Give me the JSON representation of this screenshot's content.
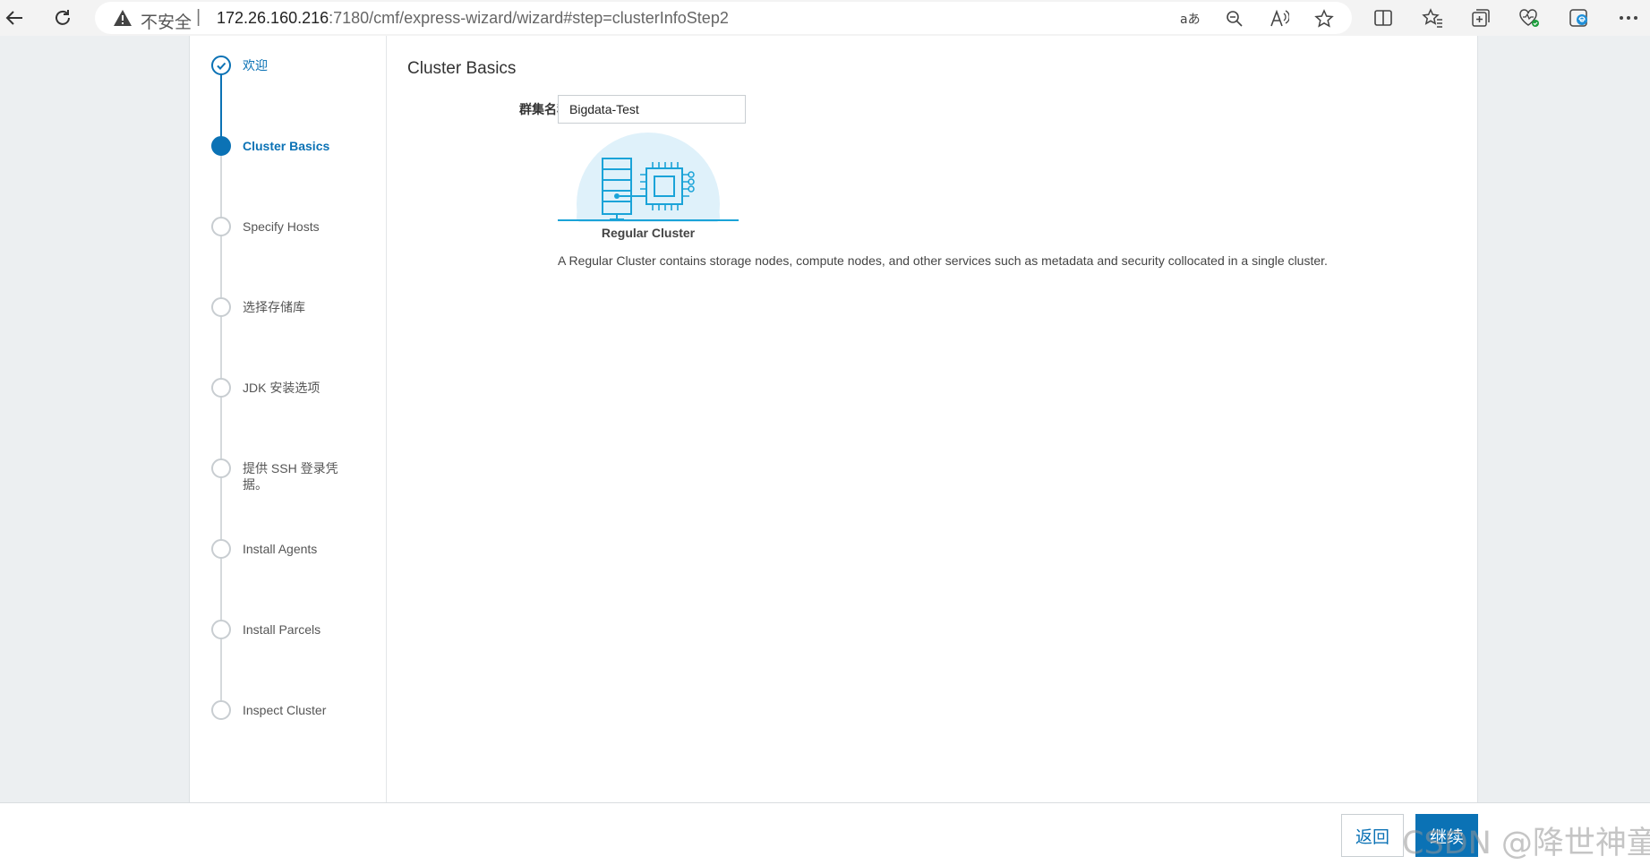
{
  "browser": {
    "security_label": "不安全",
    "separator": "|",
    "url_host": "172.26.160.216",
    "url_path": ":7180/cmf/express-wizard/wizard#step=clusterInfoStep2",
    "icons": [
      "back-icon",
      "reload-icon",
      "warning-icon",
      "translate-icon",
      "zoom-out-icon",
      "read-aloud-icon",
      "favorite-star-icon",
      "split-screen-icon",
      "favorites-icon",
      "collections-icon",
      "browser-essentials-icon",
      "edge-sidebar-icon",
      "more-icon"
    ]
  },
  "wizard": {
    "steps": [
      {
        "label": "欢迎",
        "state": "done"
      },
      {
        "label": "Cluster Basics",
        "state": "active"
      },
      {
        "label": "Specify Hosts",
        "state": "pending"
      },
      {
        "label": "选择存储库",
        "state": "pending"
      },
      {
        "label": "JDK 安装选项",
        "state": "pending"
      },
      {
        "label": "提供 SSH 登录凭据。",
        "state": "pending"
      },
      {
        "label": "Install Agents",
        "state": "pending"
      },
      {
        "label": "Install Parcels",
        "state": "pending"
      },
      {
        "label": "Inspect Cluster",
        "state": "pending"
      }
    ]
  },
  "main": {
    "section_title": "Cluster Basics",
    "cluster_name_label": "群集名称",
    "cluster_name_value": "Bigdata-Test",
    "cluster_type_label": "Regular Cluster",
    "cluster_type_description": "A Regular Cluster contains storage nodes, compute nodes, and other services such as metadata and security collocated in a single cluster."
  },
  "footer": {
    "back_label": "返回",
    "next_label": "继续",
    "watermark": "CSDN @降世神童"
  },
  "colors": {
    "accent": "#0b72b5",
    "illustration_bg": "#dff1fa",
    "illustration_line": "#1aa3d8"
  }
}
